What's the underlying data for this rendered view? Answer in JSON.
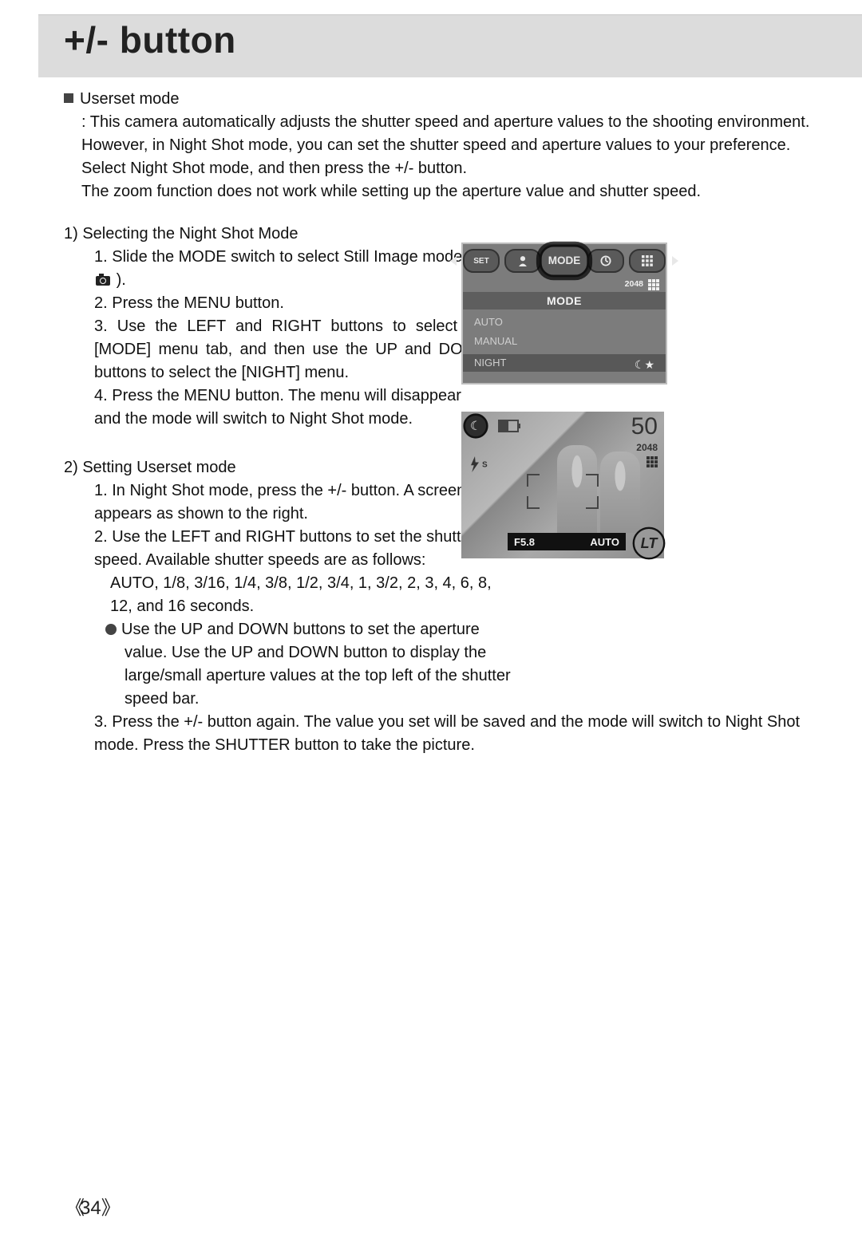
{
  "header": {
    "title": "+/- button"
  },
  "userset": {
    "heading": "Userset mode",
    "intro1": ": This camera automatically adjusts the shutter speed and aperture values to the shooting environment. However, in Night Shot mode, you can set the shutter speed and aperture values to your preference. Select Night Shot mode, and then press the +/- button.",
    "intro2": "The zoom function does not work while setting up the aperture value and shutter speed."
  },
  "sec1": {
    "title": "1) Selecting the Night Shot Mode",
    "s1a": "1. Slide the MODE switch to select Still Image mode (",
    "s1b": ").",
    "s2": "2. Press the MENU button.",
    "s3": "3. Use the LEFT and RIGHT buttons to select the [MODE] menu tab, and then use the UP and DOWN buttons to select the [NIGHT] menu.",
    "s4": "4. Press the MENU button. The menu will disappear and the mode will switch to Night Shot mode."
  },
  "sec2": {
    "title": "2) Setting Userset mode",
    "s1": "1. In Night Shot mode, press the +/- button. A screen appears as shown to the right.",
    "s2": "2. Use the LEFT and RIGHT buttons to set the shutter speed. Available shutter speeds are as follows:",
    "s2b": "AUTO, 1/8, 3/16, 1/4, 3/8, 1/2, 3/4, 1, 3/2, 2, 3, 4, 6, 8, 12, and 16 seconds.",
    "bullet1": "Use the UP and DOWN buttons to set the aperture value. Use the UP and DOWN button to display the large/small aperture values at the top left of the shutter speed bar.",
    "s3": "3. Press the +/- button again. The value you set will be saved and the mode will switch to Night Shot mode. Press the SHUTTER button to take the picture."
  },
  "fig1": {
    "pill_set": "SET",
    "pill_mode": "MODE",
    "res": "2048",
    "hdr": "MODE",
    "auto": "AUTO",
    "manual": "MANUAL",
    "night": "NIGHT"
  },
  "fig2": {
    "shots": "50",
    "res": "2048",
    "aperture": "F5.8",
    "auto": "AUTO",
    "lt": "LT",
    "flash": "ƒ",
    "flash_s": "S"
  },
  "page_number": "34"
}
